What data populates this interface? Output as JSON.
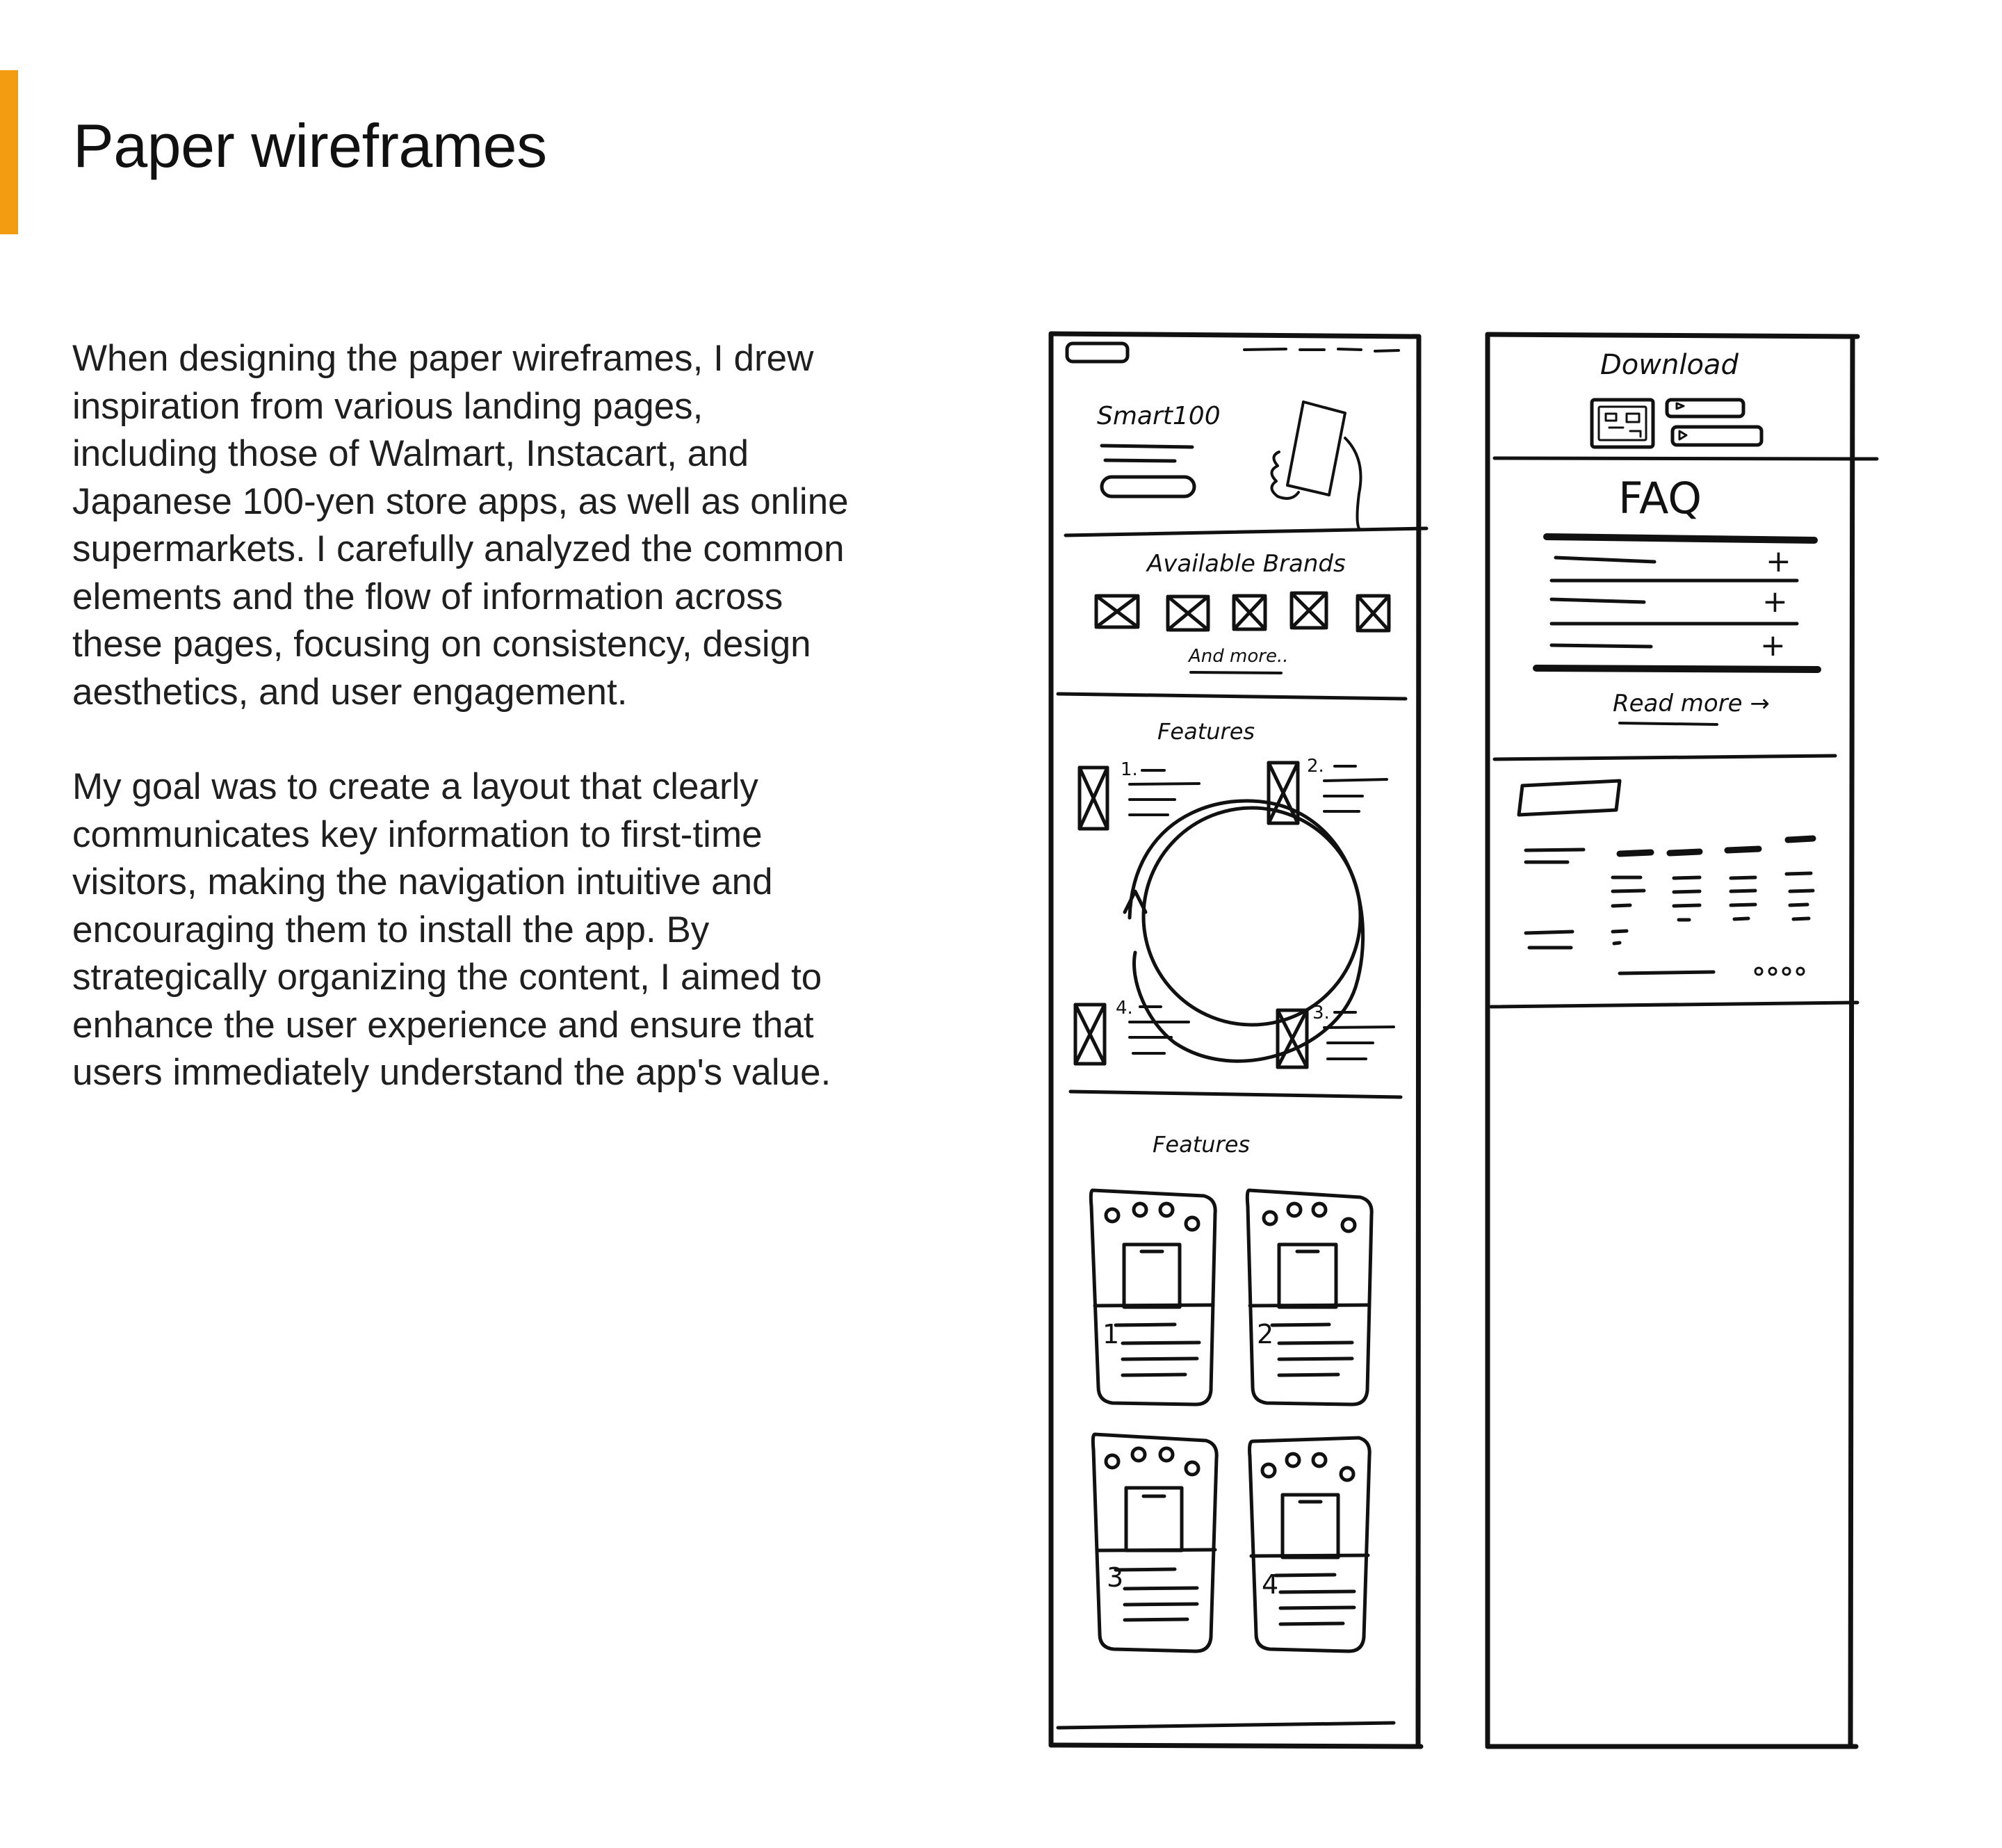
{
  "page": {
    "title": "Paper wireframes",
    "accent_color": "#f39c12",
    "paragraphs": [
      "When designing the paper wireframes, I drew\ninspiration from various landing pages,\nincluding those of Walmart, Instacart, and\nJapanese 100-yen store apps, as well as online\nsupermarkets. I carefully analyzed the common\nelements and the flow of information across\nthese pages, focusing on consistency, design\naesthetics, and user engagement.",
      "My goal was to create a layout that clearly\ncommunicates key information to first-time\nvisitors, making the navigation intuitive and\nencouraging them to install the app. By\nstrategically organizing the content, I aimed to\nenhance the user experience and ensure that\nusers immediately understand the app's value."
    ]
  },
  "sketch_left": {
    "brand": "Smart100",
    "brands_heading": "Available Brands",
    "and_more": "And more..",
    "features_heading_1": "Features",
    "feature_nums": [
      "1.",
      "2.",
      "3.",
      "4."
    ],
    "features_heading_2": "Features",
    "card_nums": [
      "1",
      "2",
      "3",
      "4"
    ]
  },
  "sketch_right": {
    "download_heading": "Download",
    "faq_heading": "FAQ",
    "read_more": "Read more →",
    "plus": "+"
  }
}
